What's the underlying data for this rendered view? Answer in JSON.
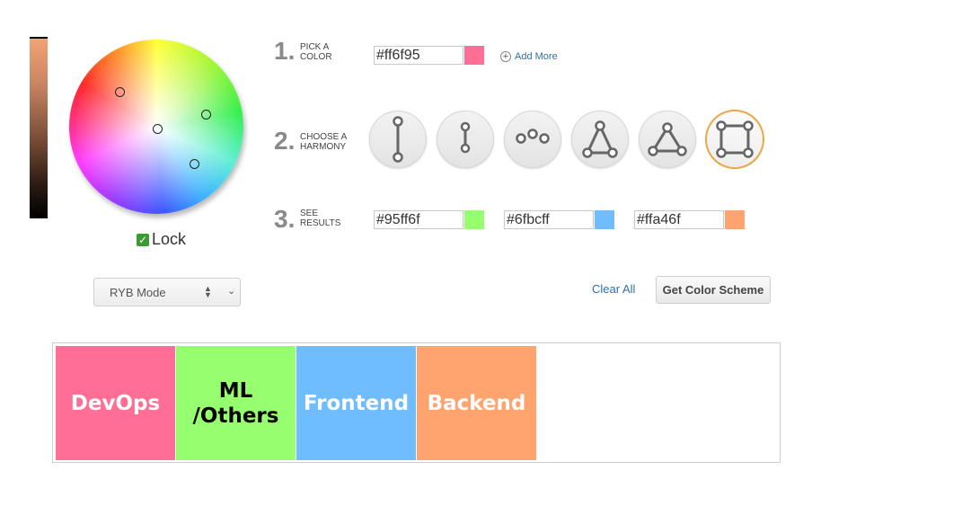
{
  "picker": {
    "lock_label": "Lock",
    "lock_checked": true,
    "mode_label": "RYB Mode"
  },
  "steps": {
    "pick": {
      "num": "1.",
      "line1": "PICK A",
      "line2": "COLOR",
      "hex": "#ff6f95",
      "swatch": "#ff6f95",
      "add_more": "Add More"
    },
    "harmony": {
      "num": "2.",
      "line1": "CHOOSE A",
      "line2": "HARMONY",
      "options": [
        "complementary",
        "split",
        "analogous",
        "triad",
        "triangle",
        "square"
      ],
      "active": "square"
    },
    "results": {
      "num": "3.",
      "line1": "SEE",
      "line2": "RESULTS",
      "colors": [
        {
          "hex": "#95ff6f",
          "swatch": "#95ff6f"
        },
        {
          "hex": "#6fbcff",
          "swatch": "#6fbcff"
        },
        {
          "hex": "#ffa46f",
          "swatch": "#ffa46f"
        }
      ]
    }
  },
  "actions": {
    "clear_all": "Clear All",
    "get_scheme": "Get Color Scheme"
  },
  "palette": [
    {
      "label": "DevOps",
      "color": "#ff6f95",
      "text_color": "#ffffff"
    },
    {
      "label": "ML\n/Others",
      "color": "#95ff6f",
      "text_color": "#000000"
    },
    {
      "label": "Frontend",
      "color": "#6fbcff",
      "text_color": "#ffffff"
    },
    {
      "label": "Backend",
      "color": "#ffa46f",
      "text_color": "#ffffff"
    }
  ]
}
